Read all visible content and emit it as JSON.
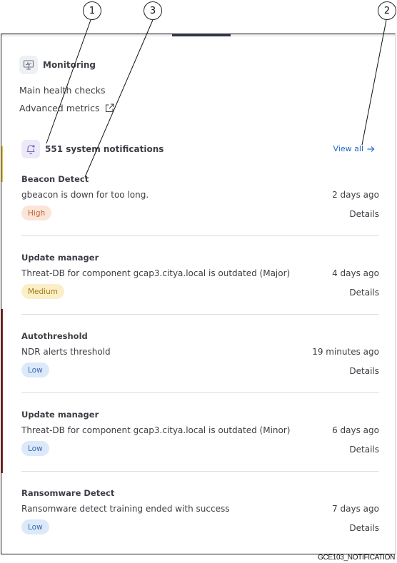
{
  "callouts": [
    "1",
    "2",
    "3"
  ],
  "monitoring": {
    "title": "Monitoring",
    "icon": "monitor-icon",
    "links": [
      {
        "label": "Main health checks"
      },
      {
        "label": "Advanced metrics",
        "icon": "external-link-icon"
      }
    ]
  },
  "notifications": {
    "icon": "bell-icon",
    "count_label": "551 system notifications",
    "view_all": "View all",
    "items": [
      {
        "title": "Beacon Detect",
        "description": "gbeacon is down for too long.",
        "time": "2 days ago",
        "severity": "High",
        "severity_class": "high",
        "details": "Details"
      },
      {
        "title": "Update manager",
        "description": "Threat-DB for component gcap3.citya.local is outdated (Major)",
        "time": "4 days ago",
        "severity": "Medium",
        "severity_class": "medium",
        "details": "Details"
      },
      {
        "title": "Autothreshold",
        "description": "NDR alerts threshold",
        "time": "19 minutes ago",
        "severity": "Low",
        "severity_class": "low",
        "details": "Details"
      },
      {
        "title": "Update manager",
        "description": "Threat-DB for component gcap3.citya.local is outdated (Minor)",
        "time": "6 days ago",
        "severity": "Low",
        "severity_class": "low",
        "details": "Details"
      },
      {
        "title": "Ransomware Detect",
        "description": "Ransomware detect training ended with success",
        "time": "7 days ago",
        "severity": "Low",
        "severity_class": "low",
        "details": "Details"
      }
    ]
  },
  "colors": {
    "accent_link": "#2369c5",
    "high": "#fbe5d9",
    "medium": "#fbefc8",
    "low": "#dce9fa"
  },
  "figure_code": "GCE103_NOTIFICATION"
}
